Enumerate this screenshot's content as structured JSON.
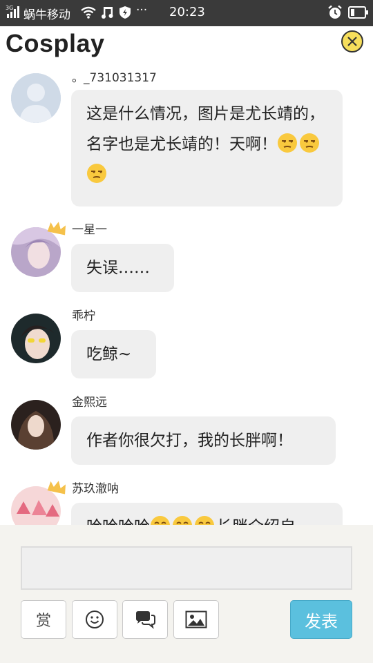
{
  "status_bar": {
    "network": "3G",
    "carrier": "蜗牛移动",
    "dots": "···",
    "time": "20:23"
  },
  "header": {
    "title": "Cosplay",
    "close_icon": "close-icon"
  },
  "messages": [
    {
      "username": "。_731031317",
      "text": "这是什么情况，图片是尤长靖的，名字也是尤长靖的！天啊！",
      "emojis": [
        "unamused-face",
        "unamused-face",
        "unamused-face"
      ],
      "crown": false
    },
    {
      "username": "一星一",
      "text": "失误……",
      "emojis": [],
      "crown": true
    },
    {
      "username": "乖柠",
      "text": "吃鲸~",
      "emojis": [],
      "crown": false
    },
    {
      "username": "金熙远",
      "text": "作者你很欠打，我的长胖啊！",
      "emojis": [],
      "crown": false
    },
    {
      "username": "苏玖澈呐",
      "text_before": "哈哈哈哈",
      "text_after": "长胖介绍自",
      "emojis": [
        "laughing-face",
        "laughing-face",
        "laughing-face"
      ],
      "crown": true
    }
  ],
  "composer": {
    "input_value": "",
    "reward_label": "赏",
    "emoji_icon": "smiley-icon",
    "comment_icon": "speech-bubbles-icon",
    "image_icon": "image-icon",
    "submit_label": "发表"
  },
  "colors": {
    "status_bar_bg": "#3a3a3a",
    "bubble_bg": "#efefef",
    "submit_bg": "#5bc0de",
    "close_bg": "#f6de5b",
    "crown": "#f5c14a"
  }
}
